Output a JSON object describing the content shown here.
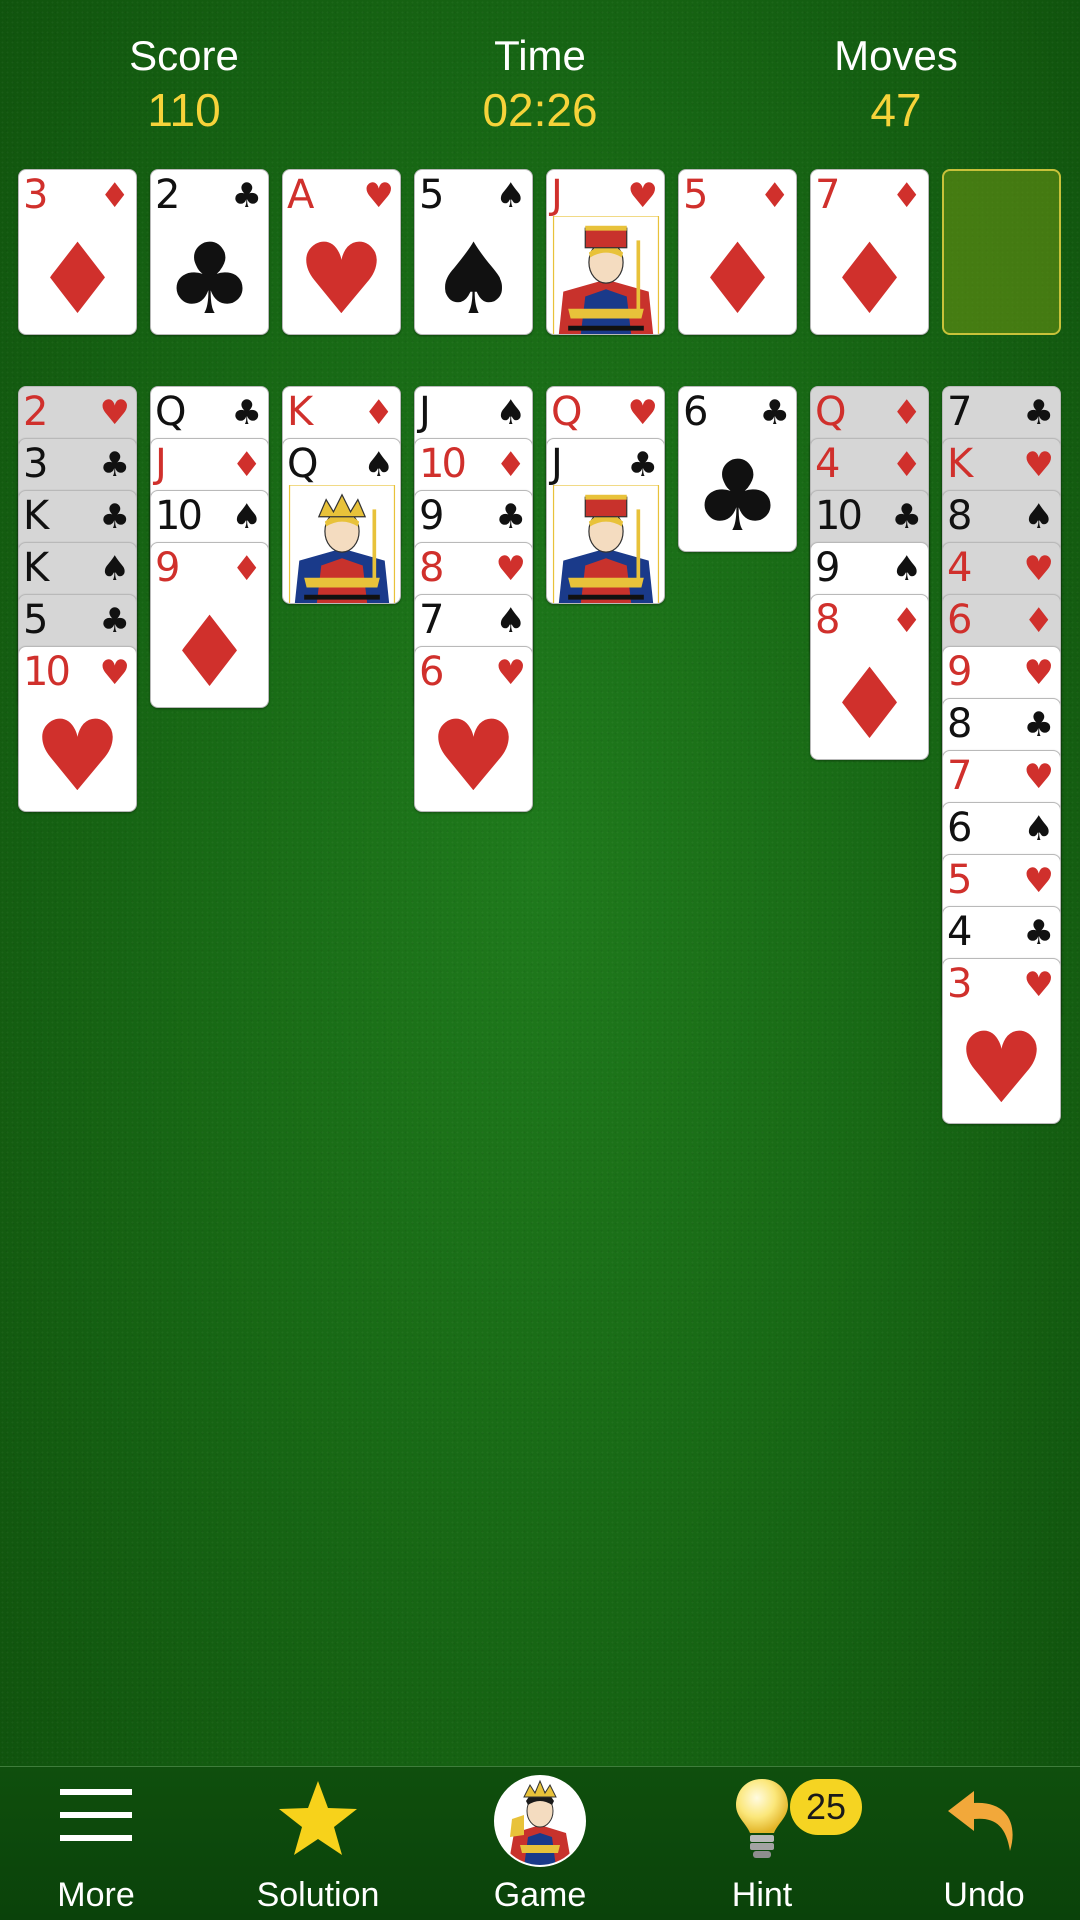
{
  "stats": {
    "score_label": "Score",
    "score_value": "110",
    "time_label": "Time",
    "time_value": "02:26",
    "moves_label": "Moves",
    "moves_value": "47"
  },
  "colors": {
    "felt": "#186915",
    "stat_value": "#f6d33a",
    "red_suit": "#d0302c",
    "black_suit": "#111111",
    "hint_badge": "#f5d422"
  },
  "top_row": [
    {
      "rank": "3",
      "suit": "♦",
      "color": "red"
    },
    {
      "rank": "2",
      "suit": "♣",
      "color": "black"
    },
    {
      "rank": "A",
      "suit": "♥",
      "color": "red"
    },
    {
      "rank": "5",
      "suit": "♠",
      "color": "black"
    },
    {
      "rank": "J",
      "suit": "♥",
      "color": "red",
      "face": "jack"
    },
    {
      "rank": "5",
      "suit": "♦",
      "color": "red"
    },
    {
      "rank": "7",
      "suit": "♦",
      "color": "red"
    },
    {
      "empty": true
    }
  ],
  "tableau": [
    [
      {
        "rank": "2",
        "suit": "♥",
        "color": "red",
        "tinted": true
      },
      {
        "rank": "3",
        "suit": "♣",
        "color": "black",
        "tinted": true
      },
      {
        "rank": "K",
        "suit": "♣",
        "color": "black",
        "tinted": true
      },
      {
        "rank": "K",
        "suit": "♠",
        "color": "black",
        "tinted": true
      },
      {
        "rank": "5",
        "suit": "♣",
        "color": "black",
        "tinted": true
      },
      {
        "rank": "10",
        "suit": "♥",
        "color": "red"
      }
    ],
    [
      {
        "rank": "Q",
        "suit": "♣",
        "color": "black"
      },
      {
        "rank": "J",
        "suit": "♦",
        "color": "red"
      },
      {
        "rank": "10",
        "suit": "♠",
        "color": "black"
      },
      {
        "rank": "9",
        "suit": "♦",
        "color": "red"
      }
    ],
    [
      {
        "rank": "K",
        "suit": "♦",
        "color": "red"
      },
      {
        "rank": "Q",
        "suit": "♠",
        "color": "black",
        "face": "queen"
      }
    ],
    [
      {
        "rank": "J",
        "suit": "♠",
        "color": "black"
      },
      {
        "rank": "10",
        "suit": "♦",
        "color": "red"
      },
      {
        "rank": "9",
        "suit": "♣",
        "color": "black"
      },
      {
        "rank": "8",
        "suit": "♥",
        "color": "red"
      },
      {
        "rank": "7",
        "suit": "♠",
        "color": "black"
      },
      {
        "rank": "6",
        "suit": "♥",
        "color": "red"
      }
    ],
    [
      {
        "rank": "Q",
        "suit": "♥",
        "color": "red"
      },
      {
        "rank": "J",
        "suit": "♣",
        "color": "black",
        "face": "jack"
      }
    ],
    [
      {
        "rank": "6",
        "suit": "♣",
        "color": "black"
      }
    ],
    [
      {
        "rank": "Q",
        "suit": "♦",
        "color": "red",
        "tinted": true
      },
      {
        "rank": "4",
        "suit": "♦",
        "color": "red",
        "tinted": true
      },
      {
        "rank": "10",
        "suit": "♣",
        "color": "black",
        "tinted": true
      },
      {
        "rank": "9",
        "suit": "♠",
        "color": "black"
      },
      {
        "rank": "8",
        "suit": "♦",
        "color": "red"
      }
    ],
    [
      {
        "rank": "7",
        "suit": "♣",
        "color": "black",
        "tinted": true
      },
      {
        "rank": "K",
        "suit": "♥",
        "color": "red",
        "tinted": true
      },
      {
        "rank": "8",
        "suit": "♠",
        "color": "black",
        "tinted": true
      },
      {
        "rank": "4",
        "suit": "♥",
        "color": "red",
        "tinted": true
      },
      {
        "rank": "6",
        "suit": "♦",
        "color": "red",
        "tinted": true
      },
      {
        "rank": "9",
        "suit": "♥",
        "color": "red"
      },
      {
        "rank": "8",
        "suit": "♣",
        "color": "black"
      },
      {
        "rank": "7",
        "suit": "♥",
        "color": "red"
      },
      {
        "rank": "6",
        "suit": "♠",
        "color": "black"
      },
      {
        "rank": "5",
        "suit": "♥",
        "color": "red"
      },
      {
        "rank": "4",
        "suit": "♣",
        "color": "black"
      },
      {
        "rank": "3",
        "suit": "♥",
        "color": "red"
      }
    ]
  ],
  "toolbar": {
    "more_label": "More",
    "more_icon": "hamburger-menu-icon",
    "solution_label": "Solution",
    "solution_icon": "star-icon",
    "game_label": "Game",
    "game_icon": "queen-card-avatar-icon",
    "hint_label": "Hint",
    "hint_icon": "light-bulb-icon",
    "hint_count": "25",
    "undo_label": "Undo",
    "undo_icon": "undo-arrow-icon"
  }
}
